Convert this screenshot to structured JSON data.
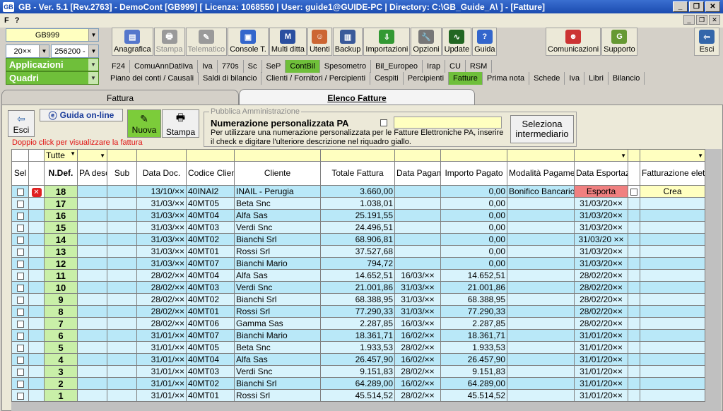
{
  "window": {
    "title": "GB - Ver. 5.1 [Rev.2763] - DemoCont [GB999]    [ Licenza: 1068550 | User: guide1@GUIDE-PC | Directory: C:\\GB_Guide_A\\ ] - [Fatture]",
    "logo": "GB"
  },
  "menu": {
    "f": "F",
    "help": "?"
  },
  "left": {
    "company": "GB999",
    "year": "20××",
    "account": "256200 -",
    "applicazioni": "Applicazioni",
    "quadri": "Quadri"
  },
  "toolbar": [
    {
      "label": "Anagrafica",
      "icon": "book-icon",
      "color": "#5577cc",
      "enabled": true
    },
    {
      "label": "Stampa",
      "icon": "printer-icon",
      "color": "#9a9a9a",
      "enabled": false
    },
    {
      "label": "Telematico",
      "icon": "telematic-icon",
      "color": "#9a9a9a",
      "enabled": false
    },
    {
      "label": "Console T.",
      "icon": "console-icon",
      "color": "#3366cc",
      "enabled": true
    },
    {
      "label": "Multi ditta",
      "icon": "multiditta-icon",
      "color": "#2a4fa0",
      "enabled": true
    },
    {
      "label": "Utenti",
      "icon": "users-icon",
      "color": "#cc6633",
      "enabled": true
    },
    {
      "label": "Backup",
      "icon": "backup-icon",
      "color": "#3a5a9a",
      "enabled": true
    },
    {
      "label": "Importazioni",
      "icon": "import-icon",
      "color": "#339933",
      "enabled": true
    },
    {
      "label": "Opzioni",
      "icon": "wrench-icon",
      "color": "#777777",
      "enabled": true
    },
    {
      "label": "Update",
      "icon": "update-icon",
      "color": "#226622",
      "enabled": true
    },
    {
      "label": "Guida",
      "icon": "help-icon",
      "color": "#3366cc",
      "enabled": true
    }
  ],
  "toolbar_right": [
    {
      "label": "Comunicazioni",
      "icon": "people-icon",
      "color": "#cc3333"
    },
    {
      "label": "Supporto",
      "icon": "support-icon",
      "color": "#669933"
    }
  ],
  "esci_top": "Esci",
  "apps_tabs": [
    "F24",
    "ComuAnnDatiIva",
    "Iva",
    "770s",
    "Sc",
    "SeP",
    "ContBil",
    "Spesometro",
    "Bil_Europeo",
    "Irap",
    "CU",
    "RSM"
  ],
  "apps_active": "ContBil",
  "quadri_tabs": [
    "Piano dei conti / Causali",
    "Saldi di bilancio",
    "Clienti / Fornitori / Percipienti",
    "Cespiti",
    "Percipienti",
    "Fatture",
    "Prima nota",
    "Schede",
    "Iva",
    "Libri",
    "Bilancio"
  ],
  "quadri_active": "Fatture",
  "page_tabs": {
    "fattura": "Fattura",
    "elenco": "Elenco Fatture"
  },
  "buttons": {
    "esci": "Esci",
    "guida": "Guida on-line",
    "nuova": "Nuova",
    "stampa": "Stampa",
    "seleziona": "Seleziona intermediario"
  },
  "hint": "Doppio click per visualizzare la fattura",
  "pa": {
    "legend": "Pubblica Amministrazione",
    "title": "Numerazione  personalizzata PA",
    "desc": "Per utilizzare una numerazione personalizzata per le Fatture Elettroniche PA, inserire il check e digitare l'ulteriore descrizione nel riquadro giallo."
  },
  "filter": {
    "ndef": "Tutte"
  },
  "columns": [
    "Sel",
    "",
    "N.Def.",
    "PA desc.",
    "Sub",
    "Data Doc.",
    "Codice Cliente",
    "Cliente",
    "Totale Fattura",
    "Data Pagamento",
    "Importo Pagato",
    "Modalità Pagamento",
    "Data Esportazione",
    "",
    "Fatturazione elettronica"
  ],
  "rows": [
    {
      "n": "18",
      "data": "13/10/××",
      "cod": "40INAI2",
      "cli": "INAIL - Perugia",
      "tot": "3.660,00",
      "dpag": "",
      "imp": "0,00",
      "mod": "Bonifico Bancario",
      "esp": "Esporta",
      "fe": "Crea",
      "del": true
    },
    {
      "n": "17",
      "data": "31/03/××",
      "cod": "40MT05",
      "cli": "Beta Snc",
      "tot": "1.038,01",
      "dpag": "",
      "imp": "0,00",
      "mod": "",
      "esp": "31/03/20××",
      "fe": ""
    },
    {
      "n": "16",
      "data": "31/03/××",
      "cod": "40MT04",
      "cli": "Alfa Sas",
      "tot": "25.191,55",
      "dpag": "",
      "imp": "0,00",
      "mod": "",
      "esp": "31/03/20××",
      "fe": ""
    },
    {
      "n": "15",
      "data": "31/03/××",
      "cod": "40MT03",
      "cli": "Verdi Snc",
      "tot": "24.496,51",
      "dpag": "",
      "imp": "0,00",
      "mod": "",
      "esp": "31/03/20××",
      "fe": ""
    },
    {
      "n": "14",
      "data": "31/03/××",
      "cod": "40MT02",
      "cli": "Bianchi Srl",
      "tot": "68.906,81",
      "dpag": "",
      "imp": "0,00",
      "mod": "",
      "esp": "31/03/20 ××",
      "fe": ""
    },
    {
      "n": "13",
      "data": "31/03/××",
      "cod": "40MT01",
      "cli": "Rossi Srl",
      "tot": "37.527,68",
      "dpag": "",
      "imp": "0,00",
      "mod": "",
      "esp": "31/03/20××",
      "fe": ""
    },
    {
      "n": "12",
      "data": "31/03/××",
      "cod": "40MT07",
      "cli": "Bianchi Mario",
      "tot": "794,72",
      "dpag": "",
      "imp": "0,00",
      "mod": "",
      "esp": "31/03/20××",
      "fe": ""
    },
    {
      "n": "11",
      "data": "28/02/××",
      "cod": "40MT04",
      "cli": "Alfa Sas",
      "tot": "14.652,51",
      "dpag": "16/03/××",
      "imp": "14.652,51",
      "mod": "",
      "esp": "28/02/20××",
      "fe": ""
    },
    {
      "n": "10",
      "data": "28/02/××",
      "cod": "40MT03",
      "cli": "Verdi Snc",
      "tot": "21.001,86",
      "dpag": "31/03/××",
      "imp": "21.001,86",
      "mod": "",
      "esp": "28/02/20××",
      "fe": ""
    },
    {
      "n": "9",
      "data": "28/02/××",
      "cod": "40MT02",
      "cli": "Bianchi Srl",
      "tot": "68.388,95",
      "dpag": "31/03/××",
      "imp": "68.388,95",
      "mod": "",
      "esp": "28/02/20××",
      "fe": ""
    },
    {
      "n": "8",
      "data": "28/02/××",
      "cod": "40MT01",
      "cli": "Rossi Srl",
      "tot": "77.290,33",
      "dpag": "31/03/××",
      "imp": "77.290,33",
      "mod": "",
      "esp": "28/02/20××",
      "fe": ""
    },
    {
      "n": "7",
      "data": "28/02/××",
      "cod": "40MT06",
      "cli": "Gamma Sas",
      "tot": "2.287,85",
      "dpag": "16/03/××",
      "imp": "2.287,85",
      "mod": "",
      "esp": "28/02/20××",
      "fe": ""
    },
    {
      "n": "6",
      "data": "31/01/××",
      "cod": "40MT07",
      "cli": "Bianchi Mario",
      "tot": "18.361,71",
      "dpag": "16/02/××",
      "imp": "18.361,71",
      "mod": "",
      "esp": "31/01/20××",
      "fe": ""
    },
    {
      "n": "5",
      "data": "31/01/××",
      "cod": "40MT05",
      "cli": "Beta Snc",
      "tot": "1.933,53",
      "dpag": "28/02/××",
      "imp": "1.933,53",
      "mod": "",
      "esp": "31/01/20××",
      "fe": ""
    },
    {
      "n": "4",
      "data": "31/01/××",
      "cod": "40MT04",
      "cli": "Alfa Sas",
      "tot": "26.457,90",
      "dpag": "16/02/××",
      "imp": "26.457,90",
      "mod": "",
      "esp": "31/01/20××",
      "fe": ""
    },
    {
      "n": "3",
      "data": "31/01/××",
      "cod": "40MT03",
      "cli": "Verdi Snc",
      "tot": "9.151,83",
      "dpag": "28/02/××",
      "imp": "9.151,83",
      "mod": "",
      "esp": "31/01/20××",
      "fe": ""
    },
    {
      "n": "2",
      "data": "31/01/××",
      "cod": "40MT02",
      "cli": "Bianchi Srl",
      "tot": "64.289,00",
      "dpag": "16/02/××",
      "imp": "64.289,00",
      "mod": "",
      "esp": "31/01/20××",
      "fe": ""
    },
    {
      "n": "1",
      "data": "31/01/××",
      "cod": "40MT01",
      "cli": "Rossi Srl",
      "tot": "45.514,52",
      "dpag": "28/02/××",
      "imp": "45.514,52",
      "mod": "",
      "esp": "31/01/20××",
      "fe": ""
    }
  ]
}
